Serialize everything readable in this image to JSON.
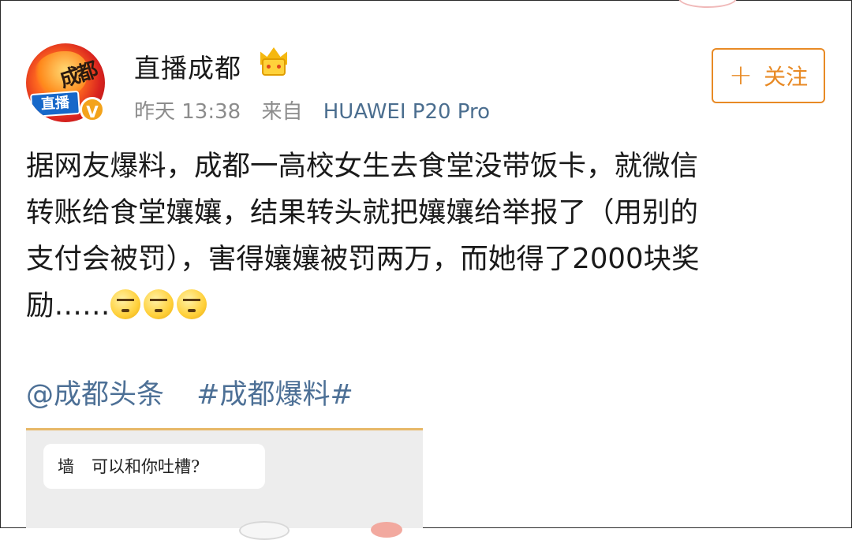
{
  "post": {
    "author": {
      "name": "直播成都",
      "avatar_text": "成都",
      "avatar_tag": "直播",
      "verified_mark": "V",
      "badge_icon": "crown-icon"
    },
    "time": "昨天 13:38",
    "source": "来自",
    "device": "HUAWEI P20 Pro",
    "follow_button": {
      "icon": "plus-icon",
      "symbol": "+",
      "label": "关注"
    },
    "text_lines": [
      "据网友爆料，成都一高校女生去食堂没带饭卡，就微信",
      "转账给食堂孃孃，结果转头就把孃孃给举报了（用别的",
      "支付会被罚），害得孃孃被罚两万，而她得了2000块奖",
      "励……"
    ],
    "emoji_icons": [
      "speechless-face-icon",
      "speechless-face-icon",
      "speechless-face-icon"
    ],
    "mention": "@成都头条",
    "hashtag": "#成都爆料#",
    "embedded_image": {
      "label": "墙",
      "prompt": "可以和你吐槽?"
    }
  },
  "colors": {
    "accent_orange": "#e88a25",
    "link_blue": "#4d7096",
    "meta_gray": "#8c8c8c"
  }
}
